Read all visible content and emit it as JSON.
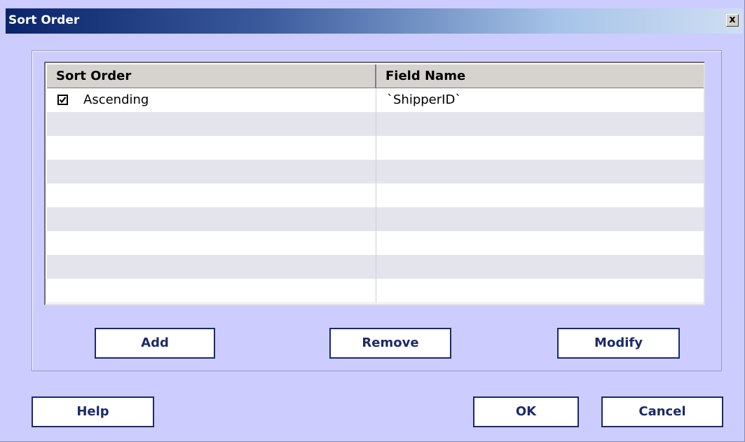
{
  "window": {
    "title": "Sort Order",
    "close_label": "x"
  },
  "table": {
    "headers": {
      "sort_order": "Sort Order",
      "field_name": "Field Name"
    },
    "rows": [
      {
        "sort_order": "Ascending",
        "field_name": "`ShipperID`",
        "checked": true
      }
    ]
  },
  "group_buttons": {
    "add": "Add",
    "remove": "Remove",
    "modify": "Modify"
  },
  "footer_buttons": {
    "help": "Help",
    "ok": "OK",
    "cancel": "Cancel"
  },
  "colors": {
    "title_gradient_start": "#0a246a",
    "dialog_bg": "#ccccfe",
    "button_border": "#1a2a6e",
    "row_alt": "#e3e4ec"
  }
}
